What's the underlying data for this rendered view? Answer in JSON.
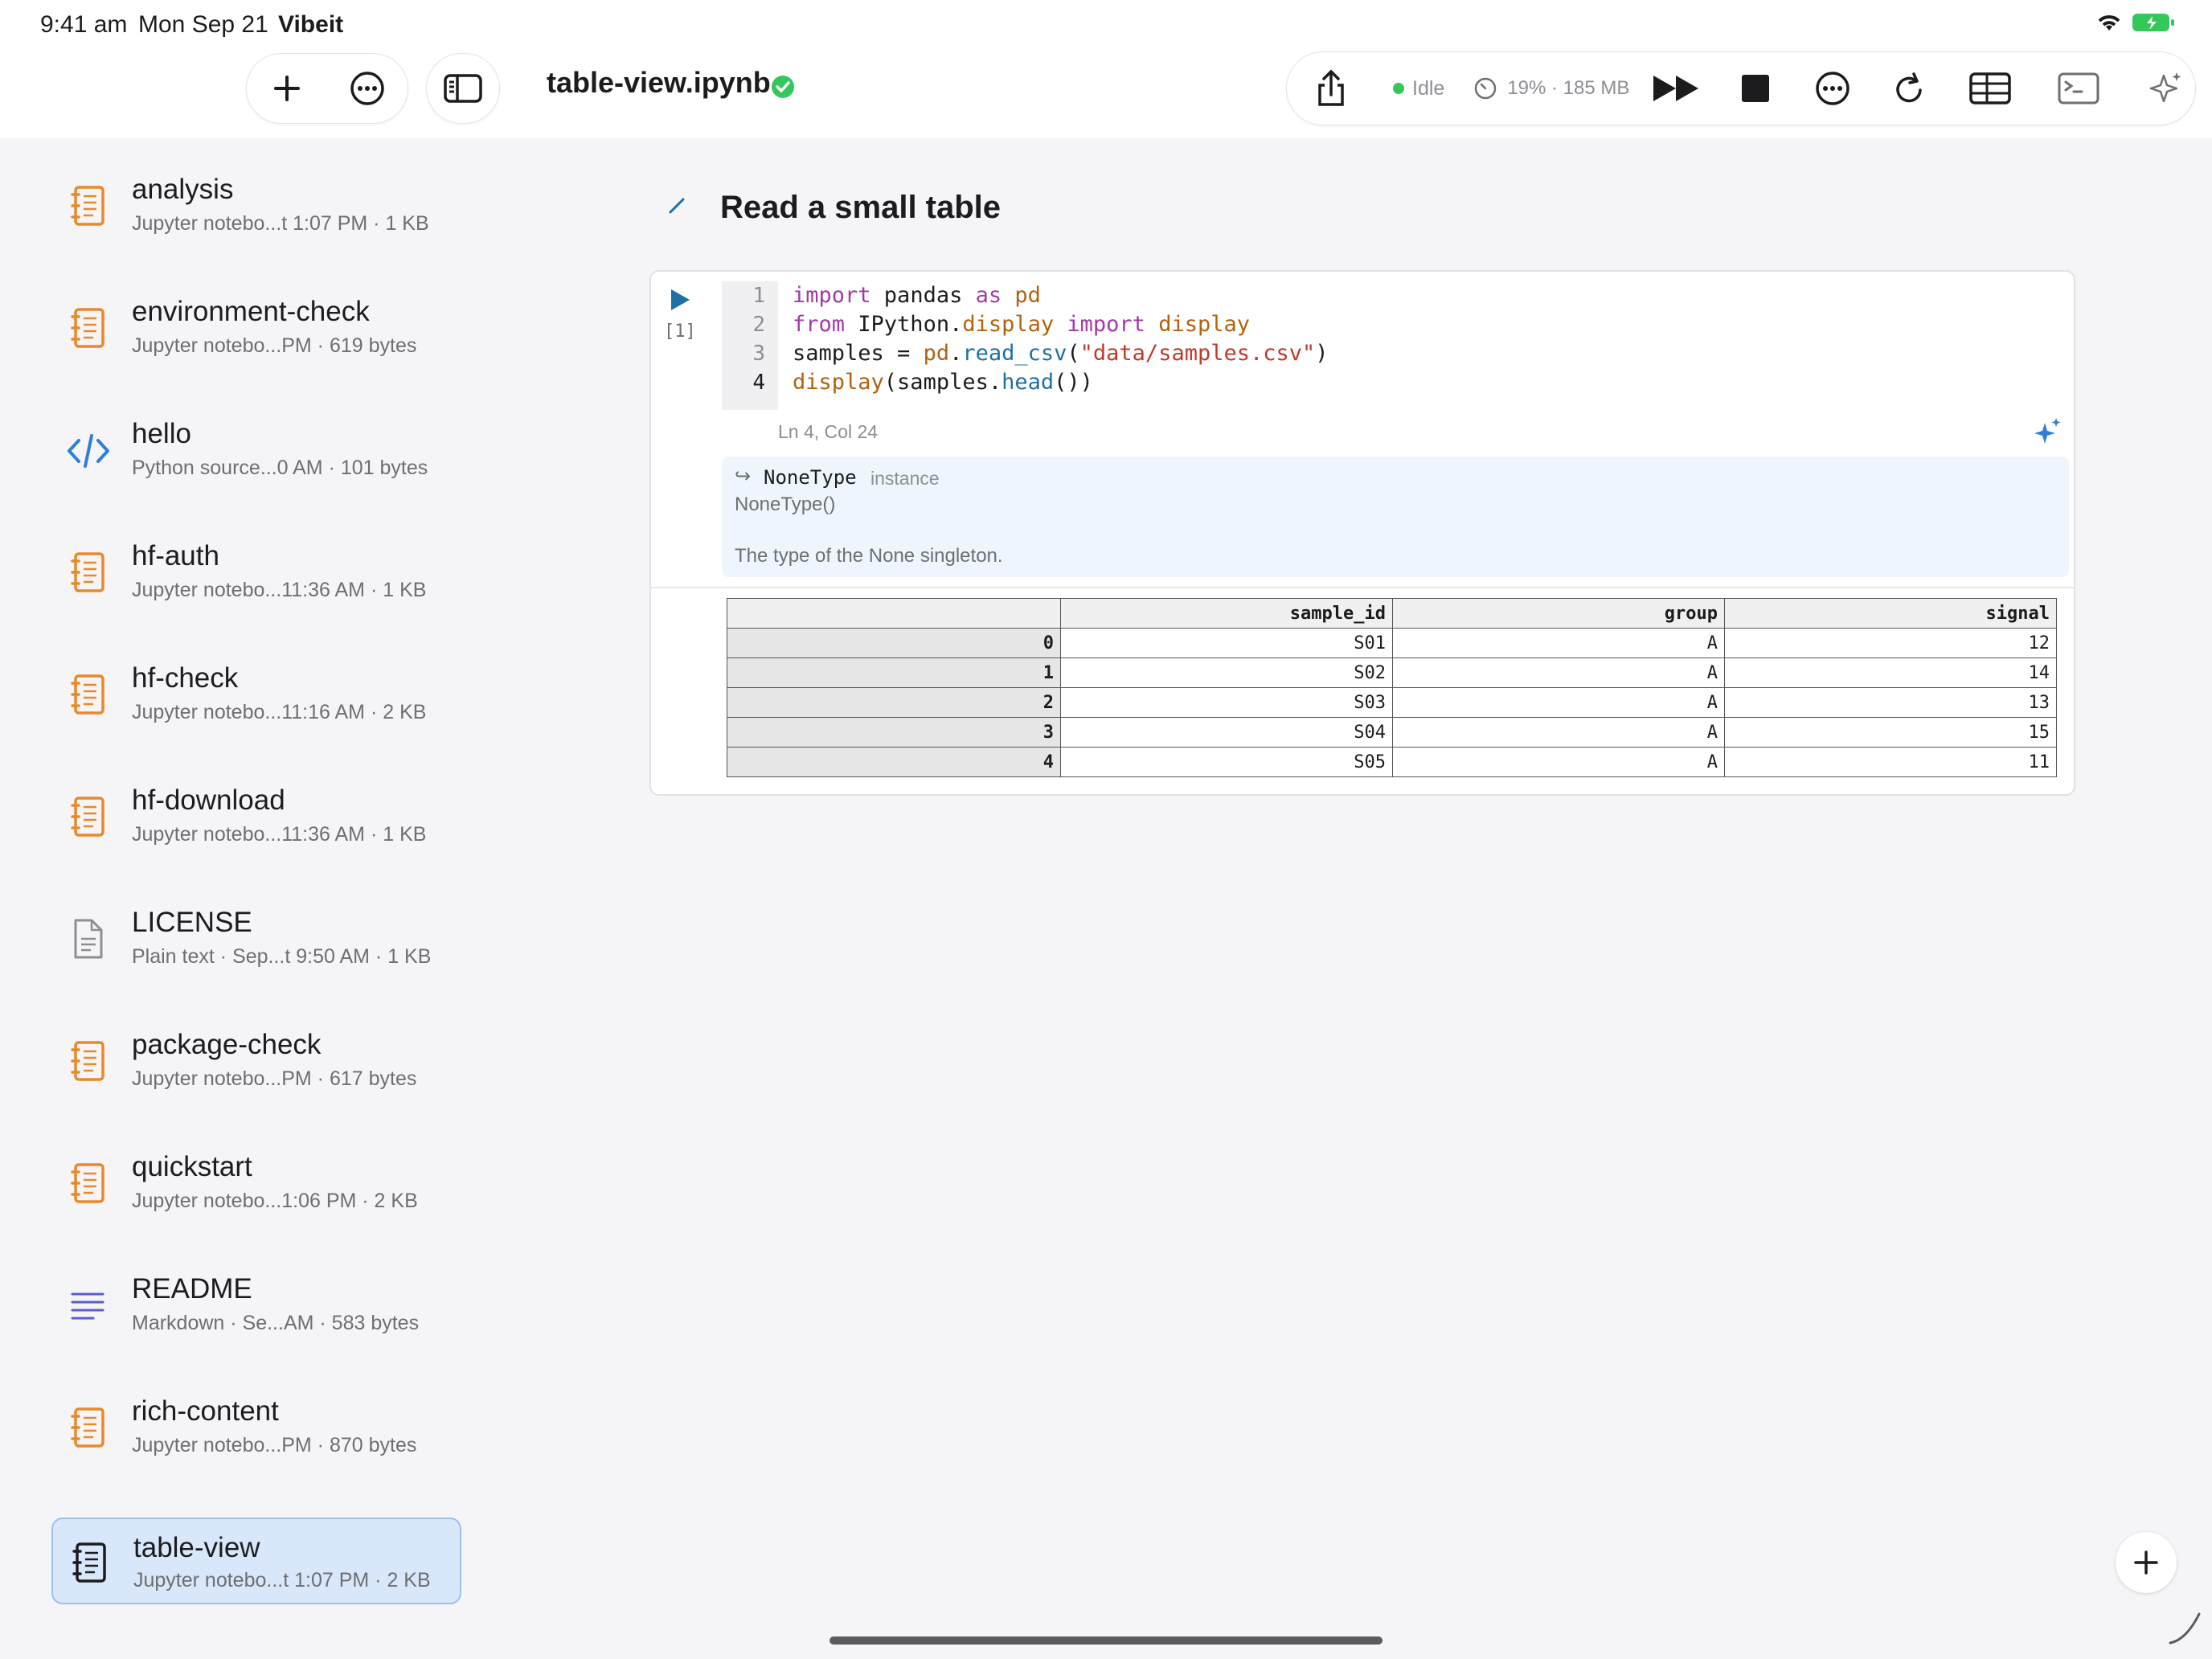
{
  "status_bar": {
    "time": "9:41 am",
    "date": "Mon Sep 21",
    "app_name": "Vibeit"
  },
  "toolbar": {
    "document_title": "table-view.ipynb",
    "kernel_status": "Idle",
    "resource_usage": "19% · 185 MB"
  },
  "sidebar": {
    "items": [
      {
        "name": "analysis",
        "meta": "Jupyter notebo...t 1:07 PM · 1 KB",
        "icon": "notebook-icon"
      },
      {
        "name": "environment-check",
        "meta": "Jupyter notebo...PM · 619 bytes",
        "icon": "notebook-icon"
      },
      {
        "name": "hello",
        "meta": "Python source...0 AM · 101 bytes",
        "icon": "code-icon"
      },
      {
        "name": "hf-auth",
        "meta": "Jupyter notebo...11:36 AM · 1 KB",
        "icon": "notebook-icon"
      },
      {
        "name": "hf-check",
        "meta": "Jupyter notebo...11:16 AM · 2 KB",
        "icon": "notebook-icon"
      },
      {
        "name": "hf-download",
        "meta": "Jupyter notebo...11:36 AM · 1 KB",
        "icon": "notebook-icon"
      },
      {
        "name": "LICENSE",
        "meta": "Plain text · Sep...t 9:50 AM · 1 KB",
        "icon": "text-file-icon"
      },
      {
        "name": "package-check",
        "meta": "Jupyter notebo...PM · 617 bytes",
        "icon": "notebook-icon"
      },
      {
        "name": "quickstart",
        "meta": "Jupyter notebo...1:06 PM · 2 KB",
        "icon": "notebook-icon"
      },
      {
        "name": "README",
        "meta": "Markdown · Se...AM · 583 bytes",
        "icon": "markdown-icon"
      },
      {
        "name": "rich-content",
        "meta": "Jupyter notebo...PM · 870 bytes",
        "icon": "notebook-icon"
      },
      {
        "name": "table-view",
        "meta": "Jupyter notebo...t 1:07 PM · 2 KB",
        "icon": "notebook-icon",
        "selected": true
      }
    ]
  },
  "notebook": {
    "heading": "Read a small table",
    "cell": {
      "execution_count": "[1]",
      "line_numbers": [
        "1",
        "2",
        "3",
        "4"
      ],
      "code_lines": [
        "import pandas as pd",
        "from IPython.display import display",
        "samples = pd.read_csv(\"data/samples.csv\")",
        "display(samples.head())"
      ],
      "cursor_position": "Ln 4, Col 24"
    },
    "tooltip": {
      "type_name": "NoneType",
      "kind": "instance",
      "signature": "NoneType()",
      "doc": "The type of the None singleton."
    },
    "output_table": {
      "columns": [
        "",
        "sample_id",
        "group",
        "signal"
      ],
      "rows": [
        [
          "0",
          "S01",
          "A",
          "12"
        ],
        [
          "1",
          "S02",
          "A",
          "14"
        ],
        [
          "2",
          "S03",
          "A",
          "13"
        ],
        [
          "3",
          "S04",
          "A",
          "15"
        ],
        [
          "4",
          "S05",
          "A",
          "11"
        ]
      ]
    }
  },
  "colors": {
    "accent": "#1f6fa8",
    "notebook_icon": "#e8892b",
    "code_icon": "#2f7fd6",
    "markdown_icon": "#5b5bd6",
    "selection": "#d9e7fa",
    "success": "#34c759"
  }
}
